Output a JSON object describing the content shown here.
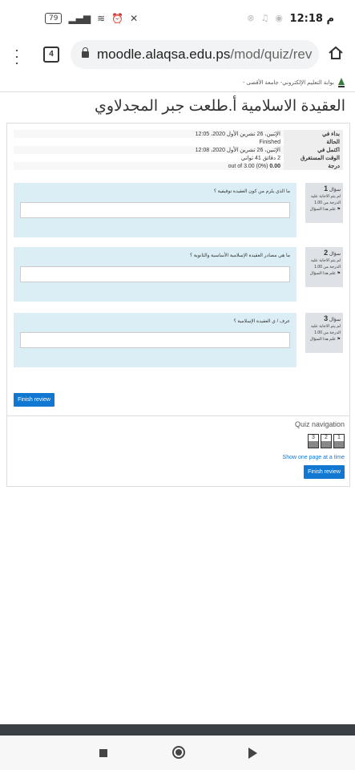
{
  "status_bar": {
    "time": "12:18",
    "ampm": "م",
    "battery": "79"
  },
  "browser": {
    "tab_count": "4",
    "url_domain": "moodle.alaqsa.edu.ps",
    "url_path": "/mod/quiz/rev"
  },
  "breadcrumb": "بوابة التعليم الإلكتروني- جامعة الأقصى -",
  "page_title": "العقيدة الاسلامية أ.طلعت جبر المجدلاوي",
  "summary": {
    "rows": [
      {
        "label": "بداء في",
        "value": "الإثنين، 26 تشرين الأول 2020، 12:05"
      },
      {
        "label": "الحالة",
        "value": "Finished"
      },
      {
        "label": "اكتمل في",
        "value": "الإثنين، 26 تشرين الأول 2020، 12:08"
      },
      {
        "label": "الوقت المستغرق",
        "value": "2 دقائق 41 ثواني"
      },
      {
        "label": "درجة",
        "value_bold": "0.00",
        "value": "out of 3.00 (0%)"
      }
    ]
  },
  "questions": [
    {
      "label": "سؤال",
      "number": "1",
      "status": "لم يتم الاجابة عليه",
      "mark": "الدرجة من 1.00",
      "flag": "علم هذا السؤال",
      "text": "ما الذي يلزم من كون العقيدة توقيفية ؟"
    },
    {
      "label": "سؤال",
      "number": "2",
      "status": "لم يتم الاجابة عليه",
      "mark": "الدرجة من 1.00",
      "flag": "علم هذا السؤال",
      "text": "ما هي مصادر العقيدة الإسلامية الأساسية والثانوية ؟"
    },
    {
      "label": "سؤال",
      "number": "3",
      "status": "لم يتم الاجابة عليه",
      "mark": "الدرجة من 1.00",
      "flag": "علم هذا السؤال",
      "text": "عرف / ي العقيدة الإسلامية ؟"
    }
  ],
  "finish_review_label": "Finish review",
  "quiz_nav": {
    "title": "Quiz navigation",
    "buttons": [
      "1",
      "2",
      "3"
    ],
    "show_one_page": "Show one page at a time",
    "finish_review": "Finish review"
  }
}
